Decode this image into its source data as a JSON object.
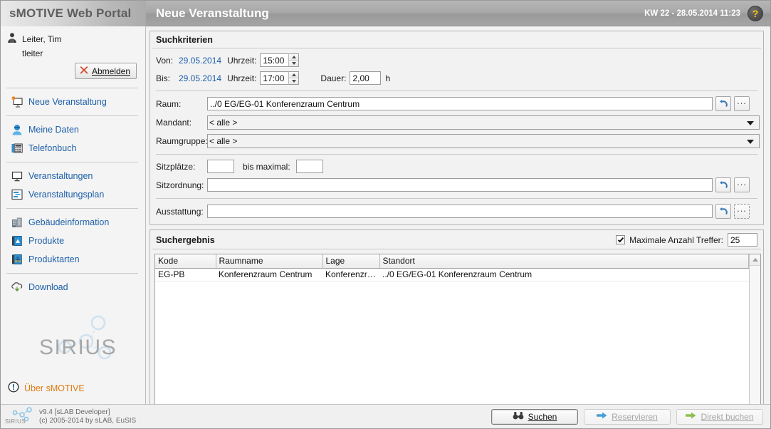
{
  "header": {
    "brand": "sMOTIVE Web Portal",
    "page_title": "Neue Veranstaltung",
    "kw_datetime": "KW 22 - 28.05.2014 11:23",
    "help_icon": "question-mark-icon"
  },
  "sidebar": {
    "user_name": "Leiter, Tim",
    "user_login": "tleiter",
    "logout_label": "Abmelden",
    "logout_accesskey": "A",
    "groups": [
      {
        "items": [
          {
            "label": "Neue Veranstaltung",
            "icon": "new-event-monitor-icon"
          }
        ]
      },
      {
        "items": [
          {
            "label": "Meine Daten",
            "icon": "user-data-icon"
          },
          {
            "label": "Telefonbuch",
            "icon": "phonebook-icon"
          }
        ]
      },
      {
        "items": [
          {
            "label": "Veranstaltungen",
            "icon": "monitor-icon"
          },
          {
            "label": "Veranstaltungsplan",
            "icon": "gantt-plan-icon"
          }
        ]
      },
      {
        "items": [
          {
            "label": "Gebäudeinformation",
            "icon": "building-icon"
          },
          {
            "label": "Produkte",
            "icon": "product-book-icon"
          },
          {
            "label": "Produktarten",
            "icon": "product-types-icon"
          }
        ]
      },
      {
        "items": [
          {
            "label": "Download",
            "icon": "cloud-download-icon"
          }
        ]
      }
    ],
    "logo_text": "SIRIUS",
    "about_label": "Über sMOTIVE",
    "about_icon": "info-exclamation-icon"
  },
  "search_panel": {
    "title": "Suchkriterien",
    "von_label": "Von:",
    "von_date": "29.05.2014",
    "von_time_label": "Uhrzeit:",
    "von_time": "15:00",
    "bis_label": "Bis:",
    "bis_date": "29.05.2014",
    "bis_time_label": "Uhrzeit:",
    "bis_time": "17:00",
    "dauer_label": "Dauer:",
    "dauer_value": "2,00",
    "dauer_unit": "h",
    "raum_label": "Raum:",
    "raum_value": "../0 EG/EG-01 Konferenzraum Centrum",
    "mandant_label": "Mandant:",
    "mandant_value": "< alle >",
    "raumgruppe_label": "Raumgruppe:",
    "raumgruppe_value": "< alle >",
    "sitzplaetze_label": "Sitzplätze:",
    "sitzplaetze_value": "",
    "bis_maximal_label": "bis maximal:",
    "bis_maximal_value": "",
    "sitzordnung_label": "Sitzordnung:",
    "sitzordnung_value": "",
    "ausstattung_label": "Ausstattung:",
    "ausstattung_value": "",
    "reset_icon": "undo-arrow-icon",
    "browse_label": "...",
    "dropdown_icon": "chevron-down-icon"
  },
  "result_panel": {
    "title": "Suchergebnis",
    "max_hits_label": "Maximale Anzahl Treffer:",
    "max_hits_checked": true,
    "max_hits_value": "25",
    "columns": [
      "Kode",
      "Raumname",
      "Lage",
      "Standort"
    ],
    "rows": [
      {
        "kode": "EG-PB",
        "raumname": "Konferenzraum Centrum",
        "lage": "Konferenzra...",
        "standort": "../0 EG/EG-01 Konferenzraum Centrum"
      }
    ]
  },
  "footer": {
    "version": "v9.4 [sLAB Developer]",
    "copyright": "(c) 2005-2014 by sLAB, EuSIS",
    "logo_text": "SIRIUS",
    "buttons": [
      {
        "label": "Suchen",
        "accesskey": "S",
        "icon": "binoculars-icon",
        "state": "enabled"
      },
      {
        "label": "Reservieren",
        "accesskey": "R",
        "icon": "blue-arrow-icon",
        "state": "disabled"
      },
      {
        "label": "Direkt buchen",
        "accesskey": "D",
        "icon": "green-arrow-icon",
        "state": "disabled"
      }
    ]
  },
  "colors": {
    "link": "#1c5fa8",
    "accent_orange": "#e07b10",
    "header_gray": "#a5a5a5",
    "help_yellow": "#ffc20e"
  }
}
